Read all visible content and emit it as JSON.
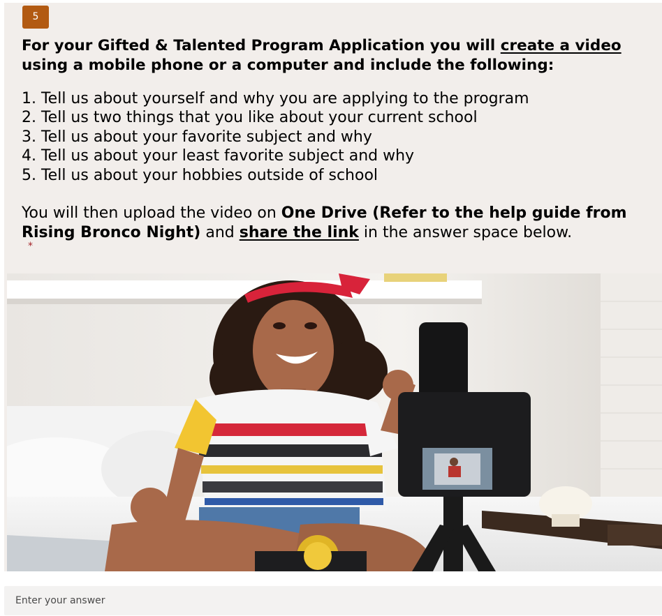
{
  "question": {
    "number": "5",
    "title_parts": [
      "For your Gifted & Talented Program Application you will ",
      "create a video",
      " using a mobile phone or a computer and include the following:"
    ],
    "steps": [
      "1. Tell us about yourself and why you are applying to the program",
      "2. Tell us two things that you like about your current school",
      "3. Tell us about your favorite subject and why",
      "4. Tell us about your least favorite subject and why",
      "5. Tell us about your hobbies outside of school"
    ],
    "upload_parts": [
      "You will then upload the video on ",
      "One Drive (Refer to the help guide from Rising Bronco Night)",
      " and ",
      "share the link",
      " in the answer space below."
    ],
    "required_marker": "*"
  },
  "image": {
    "alt": "Girl recording herself with a camera on a tripod"
  },
  "answer": {
    "placeholder": "Enter your answer",
    "value": ""
  },
  "colors": {
    "card_background": "#f2eeeb",
    "number_badge": "#b25a12",
    "required": "#a4262c",
    "input_background": "#f3f2f1"
  }
}
